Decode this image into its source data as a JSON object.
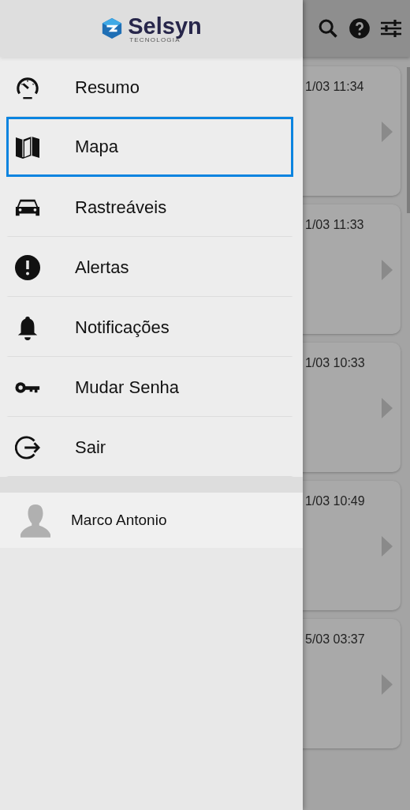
{
  "drawer": {
    "logo": {
      "name": "Selsyn",
      "tagline": "TECNOLOGIA"
    },
    "items": [
      {
        "label": "Resumo",
        "kind": "gauge",
        "selected": false
      },
      {
        "label": "Mapa",
        "kind": "map",
        "selected": true
      },
      {
        "label": "Rastreáveis",
        "kind": "car",
        "selected": false
      },
      {
        "label": "Alertas",
        "kind": "alert",
        "selected": false
      },
      {
        "label": "Notificações",
        "kind": "bell",
        "selected": false
      },
      {
        "label": "Mudar Senha",
        "kind": "key",
        "selected": false
      },
      {
        "label": "Sair",
        "kind": "exit",
        "selected": false
      }
    ],
    "user": {
      "name": "Marco Antonio"
    }
  },
  "background": {
    "cards": [
      {
        "time": "1/03 11:34"
      },
      {
        "time": "1/03 11:33"
      },
      {
        "time": "1/03 10:33"
      },
      {
        "time": "1/03 10:49"
      },
      {
        "time": "5/03 03:37"
      }
    ]
  }
}
